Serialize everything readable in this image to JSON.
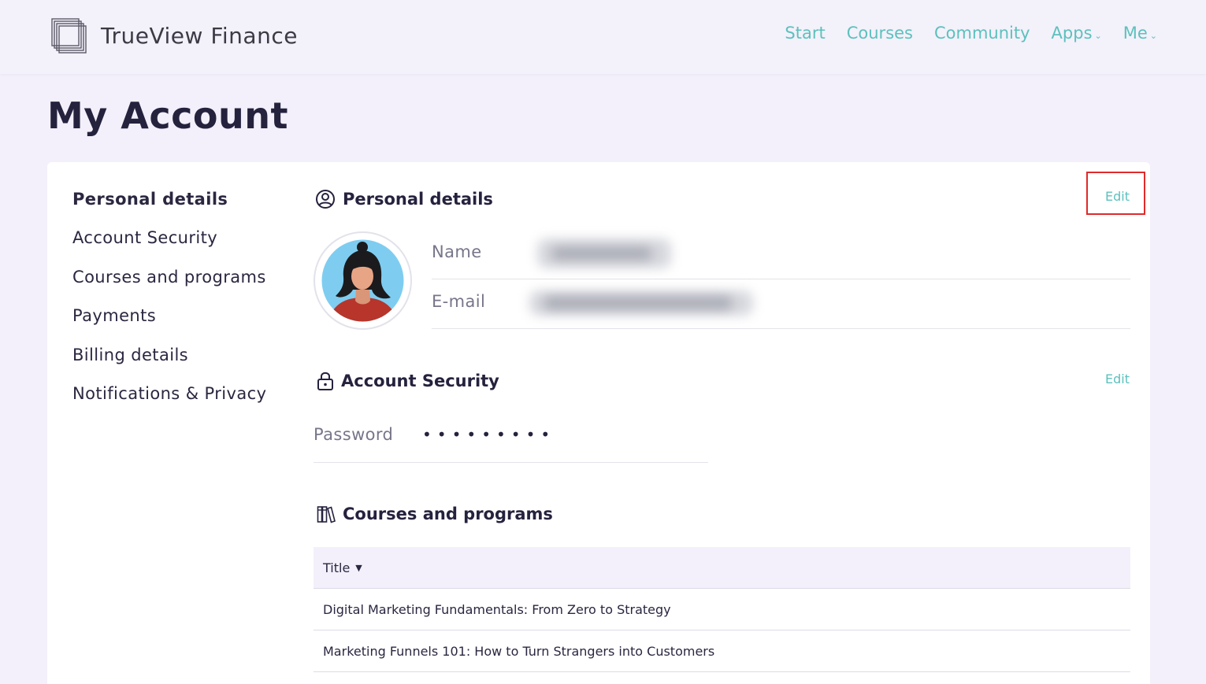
{
  "header": {
    "brand": "TrueView Finance",
    "nav": [
      {
        "label": "Start",
        "dropdown": false
      },
      {
        "label": "Courses",
        "dropdown": false
      },
      {
        "label": "Community",
        "dropdown": false
      },
      {
        "label": "Apps",
        "dropdown": true
      },
      {
        "label": "Me",
        "dropdown": true
      }
    ]
  },
  "page_title": "My Account",
  "sidebar": {
    "items": [
      {
        "label": "Personal details",
        "active": true
      },
      {
        "label": "Account Security",
        "active": false
      },
      {
        "label": "Courses and programs",
        "active": false
      },
      {
        "label": "Payments",
        "active": false
      },
      {
        "label": "Billing details",
        "active": false
      },
      {
        "label": "Notifications & Privacy",
        "active": false
      }
    ]
  },
  "personal_details": {
    "title": "Personal details",
    "edit_label": "Edit",
    "name_label": "Name",
    "email_label": "E-mail"
  },
  "account_security": {
    "title": "Account Security",
    "edit_label": "Edit",
    "password_label": "Password",
    "password_mask": "•••••••••"
  },
  "courses": {
    "title": "Courses and programs",
    "column_title": "Title",
    "rows": [
      "Digital Marketing Fundamentals: From Zero to Strategy",
      "Marketing Funnels 101: How to Turn Strangers into Customers"
    ]
  },
  "colors": {
    "accent": "#5cc1bd",
    "background": "#f3f0fb",
    "highlight_box": "#e02a2a"
  },
  "icons": [
    "logo-icon",
    "chevron-down-icon",
    "user-circle-icon",
    "lock-icon",
    "books-icon",
    "sort-down-icon"
  ]
}
